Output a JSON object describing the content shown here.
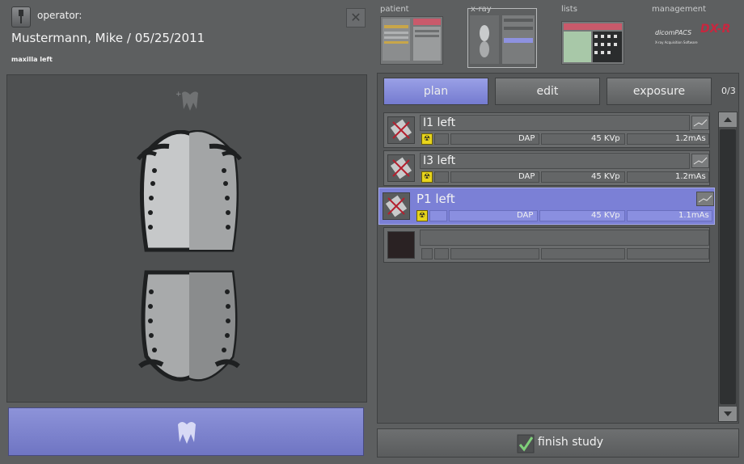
{
  "header": {
    "operator_label": "operator:",
    "patient_line": "Mustermann, Mike / 05/25/2011",
    "region_label": "maxilla left"
  },
  "nav": {
    "patient_label": "patient",
    "xray_label": "x-ray",
    "lists_label": "lists",
    "management_label": "management",
    "brand_prefix": "dicomPACS",
    "brand_mark": "DX-R",
    "brand_tagline": "X-ray Acquisition Software"
  },
  "tabs": {
    "plan": "plan",
    "edit": "edit",
    "exposure": "exposure",
    "counter": "0/3"
  },
  "exposures": [
    {
      "name": "I1 left",
      "dap": "DAP",
      "kvp": "45 KVp",
      "mas": "1.2mAs",
      "selected": false
    },
    {
      "name": "I3 left",
      "dap": "DAP",
      "kvp": "45 KVp",
      "mas": "1.2mAs",
      "selected": false
    },
    {
      "name": "P1 left",
      "dap": "DAP",
      "kvp": "45 KVp",
      "mas": "1.1mAs",
      "selected": true
    }
  ],
  "finish_label": "finish study",
  "colors": {
    "accent": "#7b80d6",
    "background": "#5d5f60",
    "radiation": "#e8d51c"
  }
}
